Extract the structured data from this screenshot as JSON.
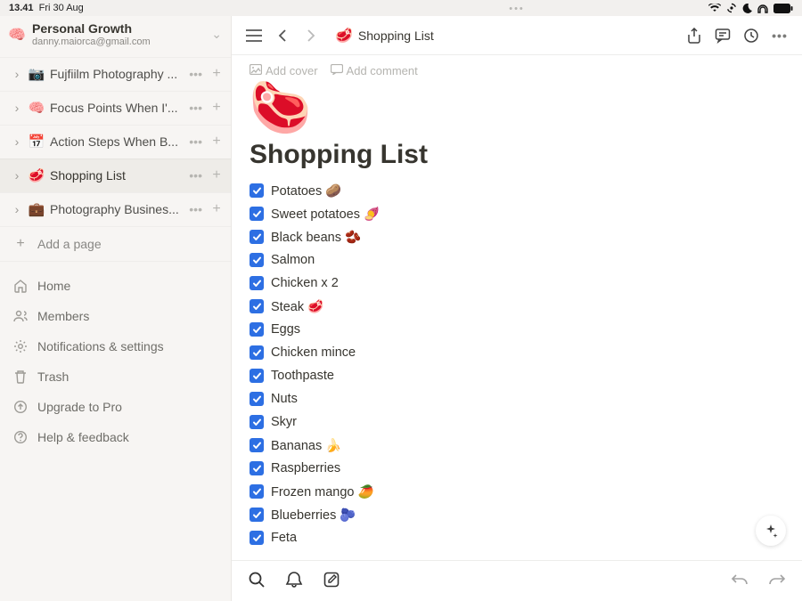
{
  "status": {
    "time": "13.41",
    "date": "Fri 30 Aug"
  },
  "workspace": {
    "icon": "🧠",
    "name": "Personal Growth",
    "email": "danny.maiorca@gmail.com"
  },
  "sidebar": {
    "pages": [
      {
        "icon": "📷",
        "label": "Fujfiilm Photography ...",
        "active": false
      },
      {
        "icon": "🧠",
        "label": "Focus Points When I'...",
        "active": false
      },
      {
        "icon": "📅",
        "label": "Action Steps When B...",
        "active": false
      },
      {
        "icon": "🥩",
        "label": "Shopping List",
        "active": true
      },
      {
        "icon": "💼",
        "label": "Photography Busines...",
        "active": false
      }
    ],
    "add_page_label": "Add a page",
    "nav": [
      {
        "icon": "home",
        "label": "Home"
      },
      {
        "icon": "members",
        "label": "Members"
      },
      {
        "icon": "settings",
        "label": "Notifications & settings"
      },
      {
        "icon": "trash",
        "label": "Trash"
      },
      {
        "icon": "upgrade",
        "label": "Upgrade to Pro"
      },
      {
        "icon": "help",
        "label": "Help & feedback"
      }
    ]
  },
  "breadcrumb": {
    "icon": "🥩",
    "title": "Shopping List"
  },
  "cover_actions": {
    "add_cover": "Add cover",
    "add_comment": "Add comment"
  },
  "page": {
    "hero_icon": "🥩",
    "title": "Shopping List",
    "items": [
      {
        "text": "Potatoes 🥔",
        "checked": true
      },
      {
        "text": "Sweet potatoes 🍠",
        "checked": true
      },
      {
        "text": "Black beans 🫘",
        "checked": true
      },
      {
        "text": "Salmon",
        "checked": true
      },
      {
        "text": "Chicken x 2",
        "checked": true
      },
      {
        "text": "Steak 🥩",
        "checked": true
      },
      {
        "text": "Eggs",
        "checked": true
      },
      {
        "text": "Chicken mince",
        "checked": true
      },
      {
        "text": "Toothpaste",
        "checked": true
      },
      {
        "text": "Nuts",
        "checked": true
      },
      {
        "text": "Skyr",
        "checked": true
      },
      {
        "text": "Bananas 🍌",
        "checked": true
      },
      {
        "text": "Raspberries",
        "checked": true
      },
      {
        "text": "Frozen mango 🥭",
        "checked": true
      },
      {
        "text": "Blueberries 🫐",
        "checked": true
      },
      {
        "text": "Feta",
        "checked": true
      }
    ]
  }
}
